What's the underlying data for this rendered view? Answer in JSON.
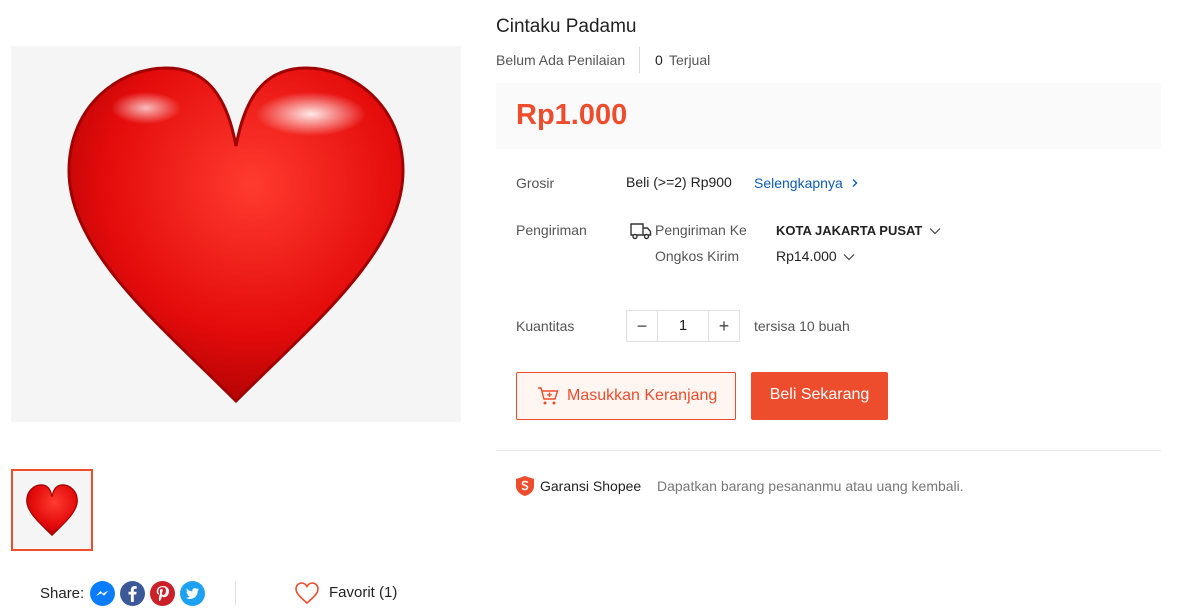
{
  "product": {
    "title": "Cintaku Padamu",
    "rating_text": "Belum Ada Penilaian",
    "sold_count": "0",
    "sold_label": "Terjual",
    "price": "Rp1.000"
  },
  "wholesale": {
    "label": "Grosir",
    "value": "Beli (>=2) Rp900",
    "link": "Selengkapnya"
  },
  "shipping": {
    "label": "Pengiriman",
    "to_label": "Pengiriman Ke",
    "destination": "KOTA JAKARTA PUSAT",
    "cost_label": "Ongkos Kirim",
    "cost": "Rp14.000"
  },
  "quantity": {
    "label": "Kuantitas",
    "value": "1",
    "minus": "−",
    "plus": "+",
    "stock": "tersisa 10 buah"
  },
  "actions": {
    "add_to_cart": "Masukkan Keranjang",
    "buy_now": "Beli Sekarang"
  },
  "guarantee": {
    "title": "Garansi Shopee",
    "description": "Dapatkan barang pesananmu atau uang kembali."
  },
  "share": {
    "label": "Share:",
    "icons": [
      "messenger-icon",
      "facebook-icon",
      "pinterest-icon",
      "twitter-icon"
    ]
  },
  "favorite": {
    "label": "Favorit (1)"
  },
  "colors": {
    "accent": "#ee4d2d",
    "link": "#0d5cb6",
    "heart": "#e01010"
  }
}
